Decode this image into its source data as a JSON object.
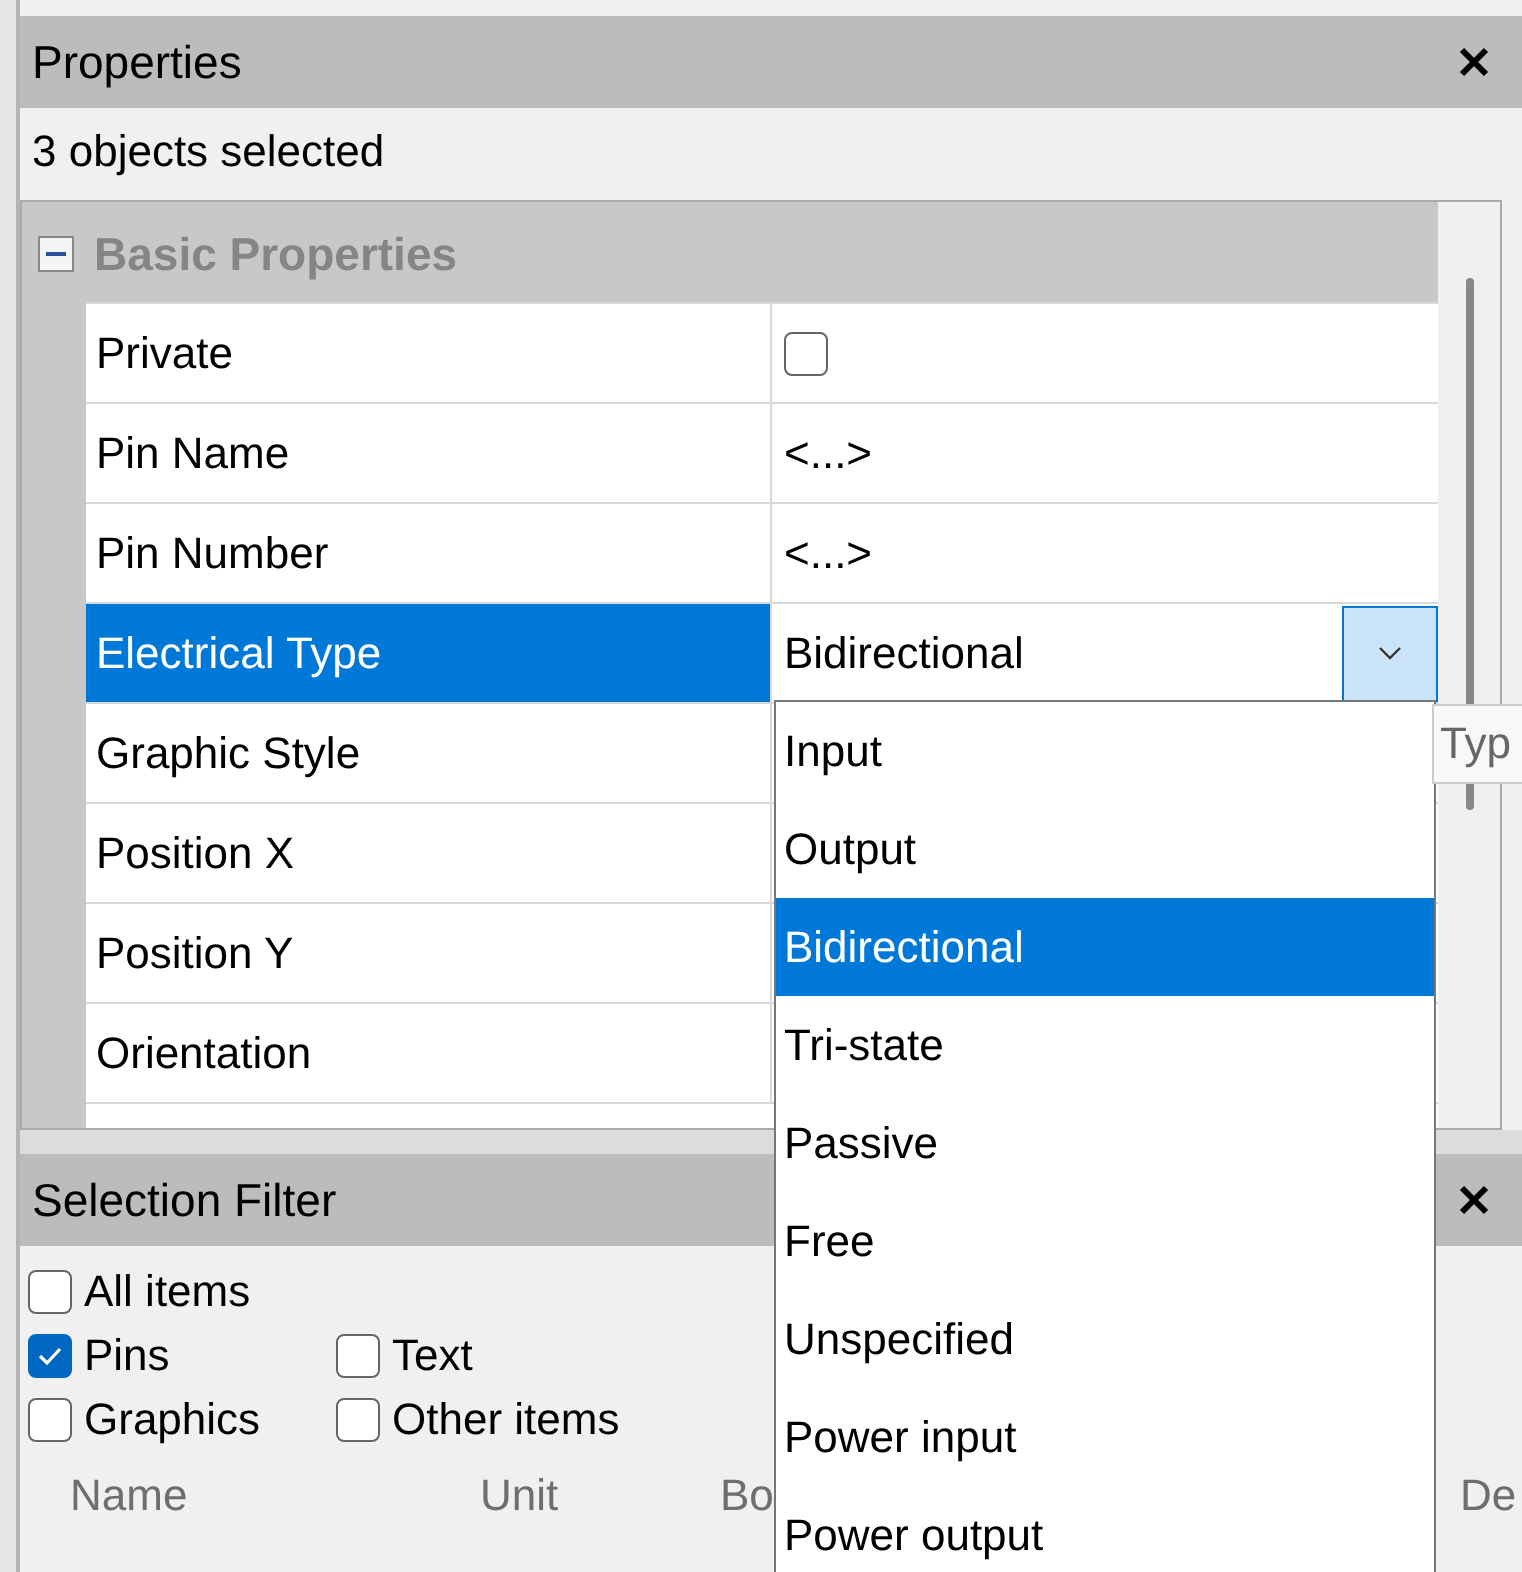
{
  "properties_panel": {
    "title": "Properties",
    "subtitle": "3 objects selected",
    "group": {
      "label": "Basic Properties",
      "expanded": true
    },
    "rows": [
      {
        "name": "Private",
        "kind": "checkbox",
        "checked": false,
        "selected": false
      },
      {
        "name": "Pin Name",
        "kind": "text",
        "value": "<...>",
        "selected": false
      },
      {
        "name": "Pin Number",
        "kind": "text",
        "value": "<...>",
        "selected": false
      },
      {
        "name": "Electrical Type",
        "kind": "dropdown",
        "value": "Bidirectional",
        "selected": true
      },
      {
        "name": "Graphic Style",
        "kind": "text",
        "selected": false
      },
      {
        "name": "Position X",
        "kind": "text",
        "selected": false
      },
      {
        "name": "Position Y",
        "kind": "text",
        "selected": false
      },
      {
        "name": "Orientation",
        "kind": "text",
        "selected": false
      }
    ]
  },
  "dropdown": {
    "options": [
      {
        "label": "Input",
        "selected": false
      },
      {
        "label": "Output",
        "selected": false
      },
      {
        "label": "Bidirectional",
        "selected": true
      },
      {
        "label": "Tri-state",
        "selected": false
      },
      {
        "label": "Passive",
        "selected": false
      },
      {
        "label": "Free",
        "selected": false
      },
      {
        "label": "Unspecified",
        "selected": false
      },
      {
        "label": "Power input",
        "selected": false
      },
      {
        "label": "Power output",
        "selected": false
      }
    ]
  },
  "tooltip": "Typ",
  "selection_filter": {
    "title": "Selection Filter",
    "checkbox_rows": [
      [
        {
          "label": "All items",
          "checked": false
        }
      ],
      [
        {
          "label": "Pins",
          "checked": true
        },
        {
          "label": "Text",
          "checked": false
        }
      ],
      [
        {
          "label": "Graphics",
          "checked": false
        },
        {
          "label": "Other items",
          "checked": false
        }
      ]
    ],
    "columns": [
      "Name",
      "Unit",
      "Bo",
      "De"
    ]
  }
}
